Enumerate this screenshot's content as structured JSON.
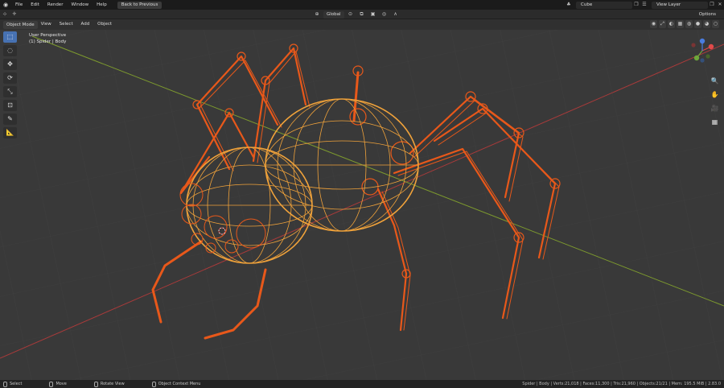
{
  "topbar": {
    "menus": [
      "File",
      "Edit",
      "Render",
      "Window",
      "Help"
    ],
    "back_button": "Back to Previous",
    "scene_name": "Cube",
    "view_layer": "View Layer"
  },
  "header": {
    "orientation": "Global",
    "options_label": "Options"
  },
  "viewport_header": {
    "mode": "Object Mode",
    "menus": [
      "View",
      "Select",
      "Add",
      "Object"
    ]
  },
  "viewport": {
    "perspective_label": "User Perspective",
    "object_label": "(1) Spider | Body"
  },
  "toolbar": {
    "tools": [
      "select-box",
      "cursor",
      "move",
      "rotate",
      "scale",
      "transform",
      "annotate",
      "measure"
    ]
  },
  "statusbar": {
    "hints": [
      {
        "label": "Select"
      },
      {
        "label": "Move"
      },
      {
        "label": "Rotate View"
      },
      {
        "label": "Object Context Menu"
      }
    ],
    "stats": "Spider | Body | Verts:21,018 | Faces:11,300 | Tris:21,960 | Objects:21/21 | Mem: 195.5 MiB | 2.83.0"
  },
  "colors": {
    "wire_orange": "#e8581a",
    "wire_yellow": "#f0a23a",
    "axis_red": "#a83a3a",
    "axis_green": "#7d9a2e",
    "accent_blue": "#4772b3"
  }
}
